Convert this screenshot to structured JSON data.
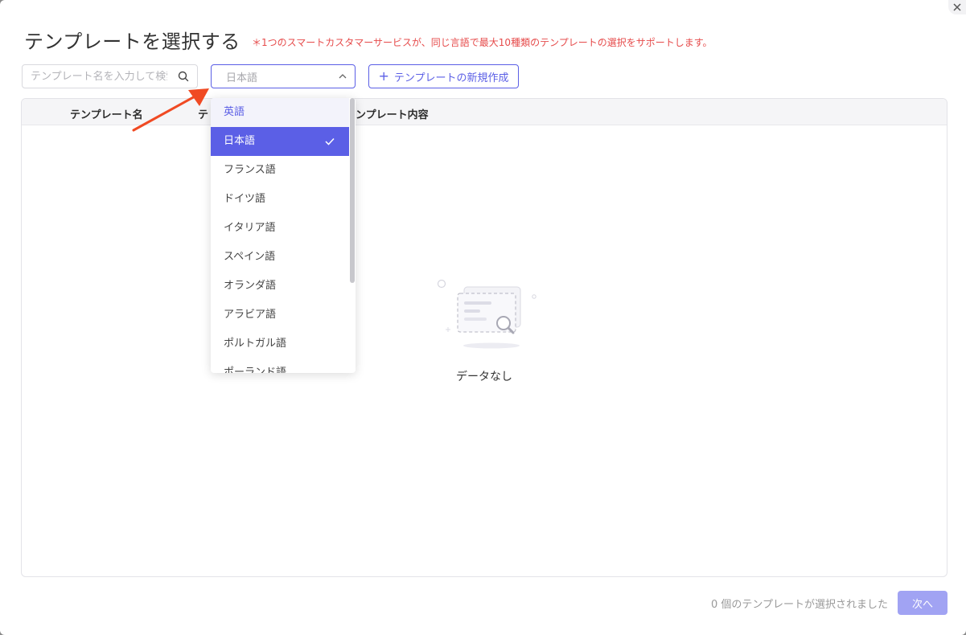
{
  "modal": {
    "title": "テンプレートを選択する",
    "notice": "＊1つのスマートカスタマーサービスが、同じ言語で最大10種類のテンプレートの選択をサポートします。"
  },
  "toolbar": {
    "search_placeholder": "テンプレート名を入力して検索",
    "language_selected": "日本語",
    "new_template_label": "テンプレートの新規作成"
  },
  "table": {
    "columns": [
      "テンプレート名",
      "テ",
      "ンプレート内容"
    ],
    "empty_text": "データなし"
  },
  "dropdown": {
    "options": [
      "英語",
      "日本語",
      "フランス語",
      "ドイツ語",
      "イタリア語",
      "スペイン語",
      "オランダ語",
      "アラビア語",
      "ポルトガル語",
      "ポーランド語"
    ],
    "hovered": "英語",
    "selected": "日本語"
  },
  "footer": {
    "selection_count": "0 個のテンプレートが選択されました",
    "next_label": "次へ"
  },
  "colors": {
    "accent": "#5b5fe6",
    "notice": "#e64b4b",
    "next_disabled": "#a1a3f3",
    "annotation_arrow": "#f04a23"
  }
}
